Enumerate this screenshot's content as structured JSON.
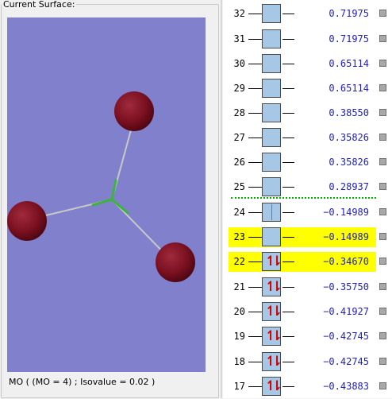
{
  "surface_panel": {
    "title": "Current Surface:",
    "status": "MO ( (MO = 4) ; Isovalue = 0.02 )",
    "background_color": "#8080cc",
    "atom_color": "#7a1020",
    "bond_color": "#c8c8c8",
    "center_color": "#3cb43c"
  },
  "mo_list": [
    {
      "num": "32",
      "energy": "0.71975",
      "occupancy": "empty",
      "highlight": false
    },
    {
      "num": "31",
      "energy": "0.71975",
      "occupancy": "empty",
      "highlight": false
    },
    {
      "num": "30",
      "energy": "0.65114",
      "occupancy": "empty",
      "highlight": false
    },
    {
      "num": "29",
      "energy": "0.65114",
      "occupancy": "empty",
      "highlight": false
    },
    {
      "num": "28",
      "energy": "0.38550",
      "occupancy": "empty",
      "highlight": false
    },
    {
      "num": "27",
      "energy": "0.35826",
      "occupancy": "empty",
      "highlight": false
    },
    {
      "num": "26",
      "energy": "0.35826",
      "occupancy": "empty",
      "highlight": false
    },
    {
      "num": "25",
      "energy": "0.28937",
      "occupancy": "empty",
      "highlight": false
    },
    {
      "num": "24",
      "energy": "−0.14989",
      "occupancy": "split",
      "highlight": false
    },
    {
      "num": "23",
      "energy": "−0.14989",
      "occupancy": "empty",
      "highlight": true
    },
    {
      "num": "22",
      "energy": "−0.34670",
      "occupancy": "double",
      "highlight": true
    },
    {
      "num": "21",
      "energy": "−0.35750",
      "occupancy": "double",
      "highlight": false
    },
    {
      "num": "20",
      "energy": "−0.41927",
      "occupancy": "double",
      "highlight": false
    },
    {
      "num": "19",
      "energy": "−0.42745",
      "occupancy": "double",
      "highlight": false
    },
    {
      "num": "18",
      "energy": "−0.42745",
      "occupancy": "double",
      "highlight": false
    },
    {
      "num": "17",
      "energy": "−0.43883",
      "occupancy": "double",
      "highlight": false
    }
  ],
  "spin_glyphs": {
    "up": "↿",
    "down": "⇂"
  },
  "colors": {
    "box_fill": "#a7c7e7",
    "energy_text": "#2020c0",
    "highlight": "#ffff00",
    "homo_lumo_line": "#00b000",
    "spin": "#d40000"
  }
}
